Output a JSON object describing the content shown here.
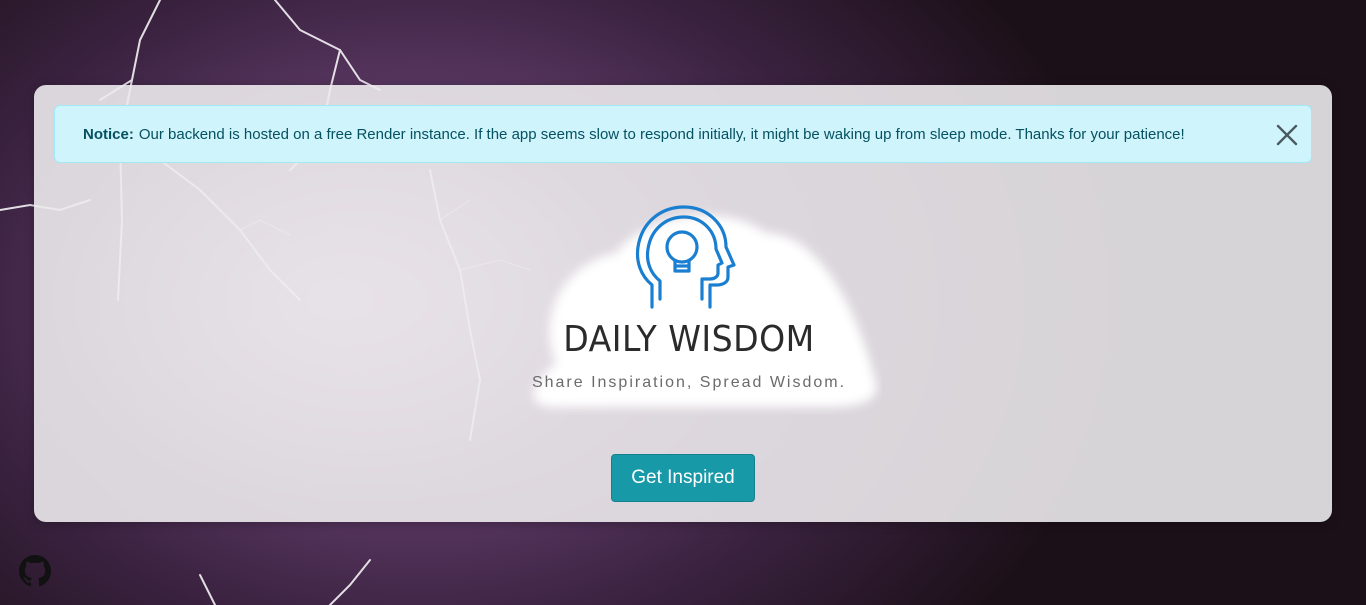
{
  "notice": {
    "label": "Notice:",
    "message": "Our backend is hosted on a free Render instance. If the app seems slow to respond initially, it might be waking up from sleep mode. Thanks for your patience!",
    "close_icon": "close-icon"
  },
  "logo": {
    "icon": "head-lightbulb-icon",
    "title": "DAILY WISDOM",
    "tagline": "Share Inspiration, Spread Wisdom."
  },
  "cta": {
    "label": "Get Inspired"
  },
  "footer": {
    "github_icon": "github-icon"
  },
  "colors": {
    "notice_bg": "#cff4fc",
    "notice_text": "#055160",
    "button_bg": "#1899a8",
    "logo_blue": "#1a7fd0"
  }
}
